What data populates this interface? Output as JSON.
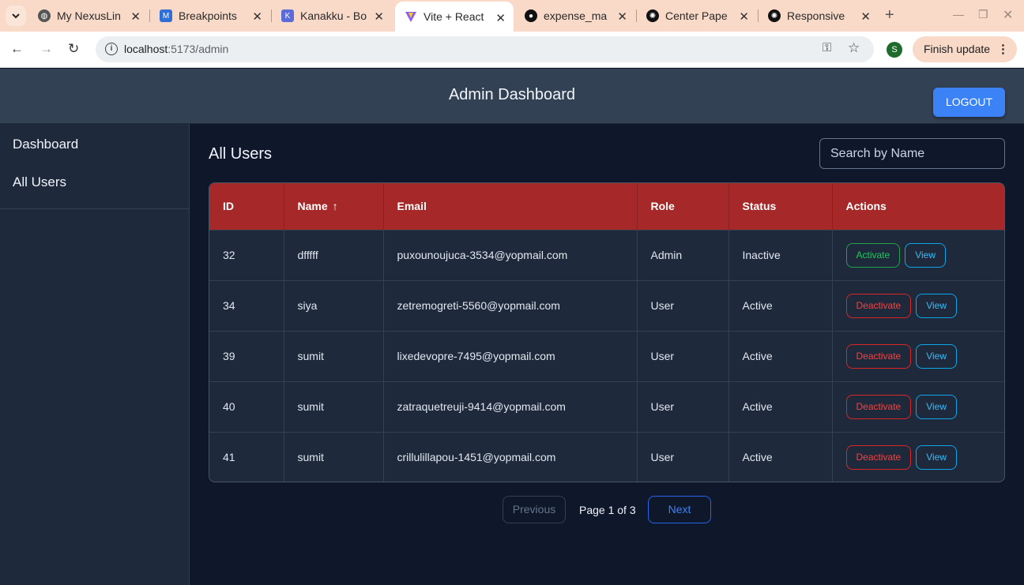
{
  "browser": {
    "tabs": [
      {
        "title": "My NexusLin",
        "favicon": "globe-icon"
      },
      {
        "title": "Breakpoints",
        "favicon": "mui-icon"
      },
      {
        "title": "Kanakku - Bo",
        "favicon": "app-icon"
      },
      {
        "title": "Vite + React",
        "favicon": "vite-icon"
      },
      {
        "title": "expense_ma",
        "favicon": "github-icon"
      },
      {
        "title": "Center Pape",
        "favicon": "openai-icon"
      },
      {
        "title": "Responsive",
        "favicon": "openai-icon"
      }
    ],
    "url_host": "localhost",
    "url_rest": ":5173/admin",
    "profile_initial": "S",
    "finish_update": "Finish update"
  },
  "header": {
    "title": "Admin Dashboard",
    "logout": "LOGOUT"
  },
  "sidebar": {
    "items": [
      {
        "label": "Dashboard"
      },
      {
        "label": "All Users"
      }
    ]
  },
  "main": {
    "title": "All Users",
    "search_placeholder": "Search by Name"
  },
  "table": {
    "headers": [
      "ID",
      "Name",
      "Email",
      "Role",
      "Status",
      "Actions"
    ],
    "rows": [
      {
        "id": "32",
        "name": "dfffff",
        "email": "puxounoujuca-3534@yopmail.com",
        "role": "Admin",
        "status": "Inactive",
        "toggle": "Activate",
        "view": "View"
      },
      {
        "id": "34",
        "name": "siya",
        "email": "zetremogreti-5560@yopmail.com",
        "role": "User",
        "status": "Active",
        "toggle": "Deactivate",
        "view": "View"
      },
      {
        "id": "39",
        "name": "sumit",
        "email": "lixedevopre-7495@yopmail.com",
        "role": "User",
        "status": "Active",
        "toggle": "Deactivate",
        "view": "View"
      },
      {
        "id": "40",
        "name": "sumit",
        "email": "zatraquetreuji-9414@yopmail.com",
        "role": "User",
        "status": "Active",
        "toggle": "Deactivate",
        "view": "View"
      },
      {
        "id": "41",
        "name": "sumit",
        "email": "crillulillapou-1451@yopmail.com",
        "role": "User",
        "status": "Active",
        "toggle": "Deactivate",
        "view": "View"
      }
    ]
  },
  "pagination": {
    "previous": "Previous",
    "info": "Page 1 of 3",
    "next": "Next"
  },
  "colors": {
    "header_bg": "#334155",
    "table_header_bg": "#a72828",
    "accent": "#3b82f6",
    "page_bg": "#0f172a"
  }
}
